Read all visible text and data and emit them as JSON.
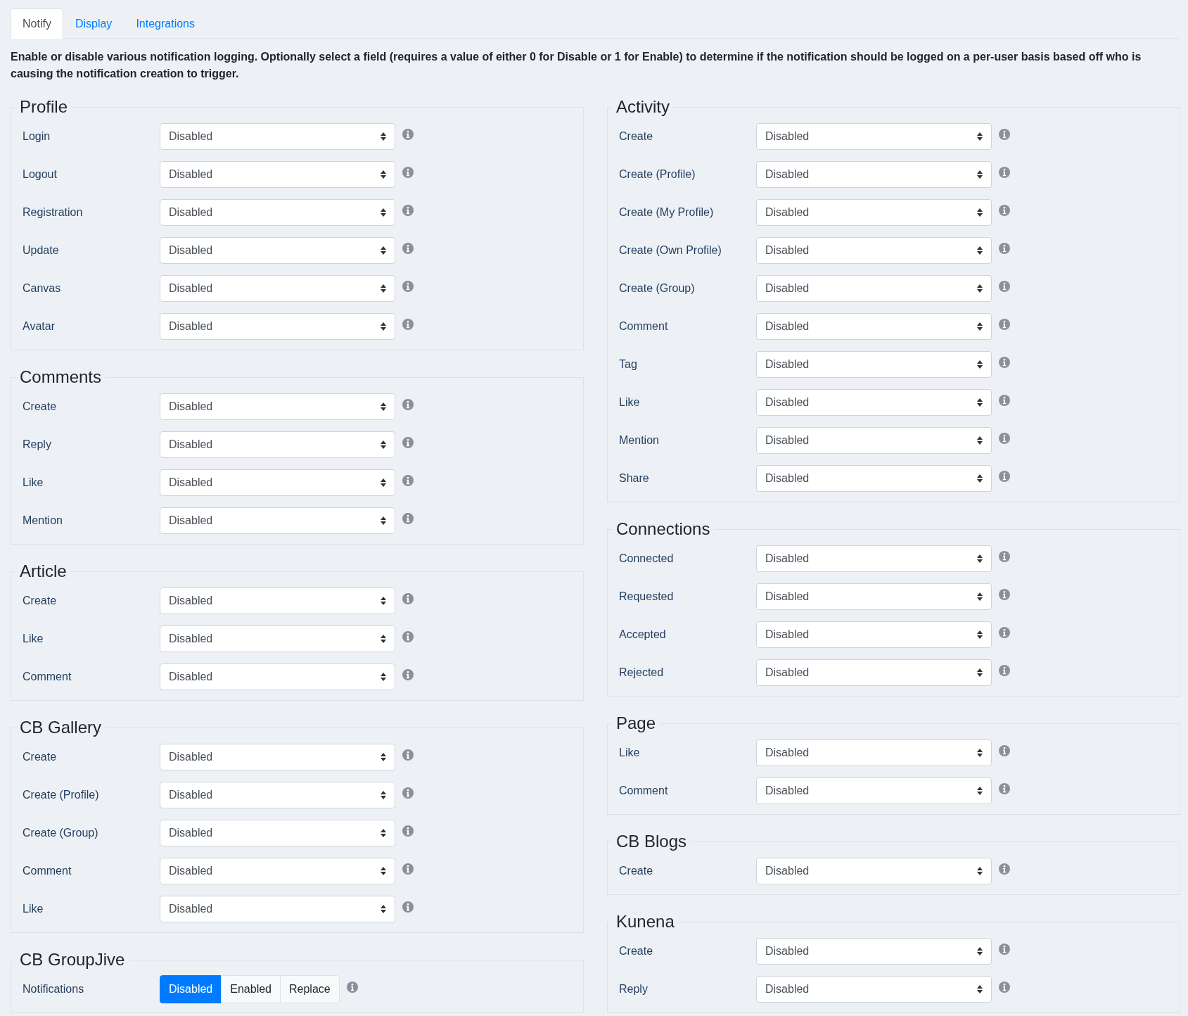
{
  "tabs": [
    {
      "label": "Notify",
      "selected": true
    },
    {
      "label": "Display",
      "selected": false
    },
    {
      "label": "Integrations",
      "selected": false
    }
  ],
  "description": "Enable or disable various notification logging. Optionally select a field (requires a value of either 0 for Disable or 1 for Enable) to determine if the notification should be logged on a per-user basis based off who is causing the notification creation to trigger.",
  "columns": [
    {
      "sections": [
        {
          "title": "Profile",
          "rows": [
            {
              "label": "Login",
              "kind": "select",
              "value": "Disabled"
            },
            {
              "label": "Logout",
              "kind": "select",
              "value": "Disabled"
            },
            {
              "label": "Registration",
              "kind": "select",
              "value": "Disabled"
            },
            {
              "label": "Update",
              "kind": "select",
              "value": "Disabled"
            },
            {
              "label": "Canvas",
              "kind": "select",
              "value": "Disabled"
            },
            {
              "label": "Avatar",
              "kind": "select",
              "value": "Disabled"
            }
          ]
        },
        {
          "title": "Comments",
          "rows": [
            {
              "label": "Create",
              "kind": "select",
              "value": "Disabled"
            },
            {
              "label": "Reply",
              "kind": "select",
              "value": "Disabled"
            },
            {
              "label": "Like",
              "kind": "select",
              "value": "Disabled"
            },
            {
              "label": "Mention",
              "kind": "select",
              "value": "Disabled"
            }
          ]
        },
        {
          "title": "Article",
          "rows": [
            {
              "label": "Create",
              "kind": "select",
              "value": "Disabled"
            },
            {
              "label": "Like",
              "kind": "select",
              "value": "Disabled"
            },
            {
              "label": "Comment",
              "kind": "select",
              "value": "Disabled"
            }
          ]
        },
        {
          "title": "CB Gallery",
          "rows": [
            {
              "label": "Create",
              "kind": "select",
              "value": "Disabled"
            },
            {
              "label": "Create (Profile)",
              "kind": "select",
              "value": "Disabled"
            },
            {
              "label": "Create (Group)",
              "kind": "select",
              "value": "Disabled"
            },
            {
              "label": "Comment",
              "kind": "select",
              "value": "Disabled"
            },
            {
              "label": "Like",
              "kind": "select",
              "value": "Disabled"
            }
          ]
        },
        {
          "title": "CB GroupJive",
          "rows": [
            {
              "label": "Notifications",
              "kind": "buttons",
              "options": [
                {
                  "label": "Disabled",
                  "selected": true
                },
                {
                  "label": "Enabled",
                  "selected": false
                },
                {
                  "label": "Replace",
                  "selected": false
                }
              ]
            }
          ]
        }
      ]
    },
    {
      "sections": [
        {
          "title": "Activity",
          "rows": [
            {
              "label": "Create",
              "kind": "select",
              "value": "Disabled"
            },
            {
              "label": "Create (Profile)",
              "kind": "select",
              "value": "Disabled"
            },
            {
              "label": "Create (My Profile)",
              "kind": "select",
              "value": "Disabled"
            },
            {
              "label": "Create (Own Profile)",
              "kind": "select",
              "value": "Disabled"
            },
            {
              "label": "Create (Group)",
              "kind": "select",
              "value": "Disabled"
            },
            {
              "label": "Comment",
              "kind": "select",
              "value": "Disabled"
            },
            {
              "label": "Tag",
              "kind": "select",
              "value": "Disabled"
            },
            {
              "label": "Like",
              "kind": "select",
              "value": "Disabled"
            },
            {
              "label": "Mention",
              "kind": "select",
              "value": "Disabled"
            },
            {
              "label": "Share",
              "kind": "select",
              "value": "Disabled"
            }
          ]
        },
        {
          "title": "Connections",
          "rows": [
            {
              "label": "Connected",
              "kind": "select",
              "value": "Disabled"
            },
            {
              "label": "Requested",
              "kind": "select",
              "value": "Disabled"
            },
            {
              "label": "Accepted",
              "kind": "select",
              "value": "Disabled"
            },
            {
              "label": "Rejected",
              "kind": "select",
              "value": "Disabled"
            }
          ]
        },
        {
          "title": "Page",
          "rows": [
            {
              "label": "Like",
              "kind": "select",
              "value": "Disabled"
            },
            {
              "label": "Comment",
              "kind": "select",
              "value": "Disabled"
            }
          ]
        },
        {
          "title": "CB Blogs",
          "rows": [
            {
              "label": "Create",
              "kind": "select",
              "value": "Disabled"
            }
          ]
        },
        {
          "title": "Kunena",
          "rows": [
            {
              "label": "Create",
              "kind": "select",
              "value": "Disabled"
            },
            {
              "label": "Reply",
              "kind": "select",
              "value": "Disabled"
            }
          ]
        }
      ]
    }
  ]
}
